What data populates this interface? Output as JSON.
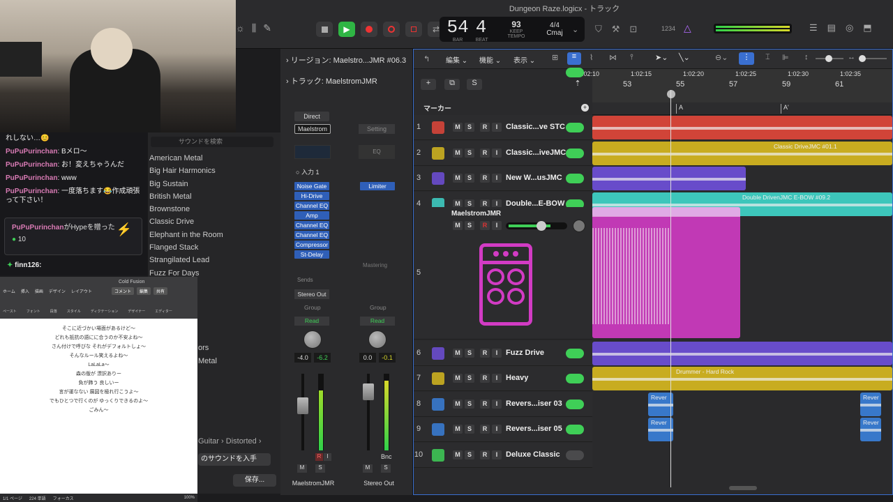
{
  "window_title": "Dungeon Raze.logicx - トラック",
  "lcd": {
    "bar": "54",
    "beat": "4",
    "bar_label": "BAR",
    "beat_label": "BEAT",
    "tempo": "93",
    "keep": "KEEP",
    "tempo_label": "TEMPO",
    "sig": "4/4",
    "key": "Cmaj",
    "count": "1234"
  },
  "chat": {
    "lines": [
      {
        "user": "",
        "text": "れしない…😊"
      },
      {
        "user": "PuPuPurinchan",
        "text": ": Bメロ〜"
      },
      {
        "user": "PuPuPurinchan",
        "text": ": お！変えちゃうんだ"
      },
      {
        "user": "PuPuPurinchan",
        "text": ": www"
      },
      {
        "user": "PuPuPurinchan",
        "text": ": 一度落ちます😂作成頑張って下さい！"
      }
    ],
    "hype_user": "PuPuPurinchan",
    "hype_text": "がHypeを贈った",
    "hype_count": "10",
    "last_user": "finn126:"
  },
  "library": {
    "search_placeholder": "サウンドを検索",
    "items": [
      "American Metal",
      "Big Hair Harmonics",
      "Big Sustain",
      "British Metal",
      "Brownstone",
      "Classic Drive",
      "Elephant in the Room",
      "Flanged Stack",
      "Strangilated Lead",
      "Fuzz For Days"
    ],
    "tail1": "ors",
    "tail2": "Metal",
    "path_guitar": "Guitar",
    "path_distorted": "Distorted",
    "get_more": "のサウンドを入手",
    "save": "保存..."
  },
  "doc": {
    "title": "Cold Fusion",
    "ribbon_tabs": [
      "ホーム",
      "挿入",
      "描画",
      "デザイン",
      "レイアウト"
    ],
    "comment": "コメント",
    "edit": "編集",
    "share": "共有",
    "tools": [
      "ペースト",
      "フォント",
      "段落",
      "スタイル",
      "ディクテーション",
      "デザイナー",
      "エディター"
    ],
    "lines": [
      "そこに近づかい場面があるけど〜",
      "どれも抵抗の語にに合うのか不安よね〜",
      "",
      "さん付けで呼びな それがデフォルトしょ〜",
      "そんなルール笑えるよね〜",
      "",
      "LaLaLa〜",
      "森の版が 漂訳ありー",
      "負が飾う 良しいー",
      "言が運なない 展図を極れ行こうよ〜",
      "でもひとつで行くのが ゆっくりできるのよ〜",
      "ごみん〜"
    ],
    "status_page": "1/1 ページ",
    "status_words": "224 単語",
    "status_focus": "フォーカス",
    "zoom": "100%"
  },
  "inspector": {
    "region_label": "リージョン: Maelstro...JMR #06.3",
    "track_label": "トラック: MaelstromJMR",
    "direct": "Direct",
    "plugin_main": "Maelstrom",
    "setting": "Setting",
    "eq": "EQ",
    "input": "入力 1",
    "inserts": [
      "Noise Gate",
      "Hi-Drive",
      "Channel EQ",
      "Amp",
      "Channel EQ",
      "Channel EQ",
      "Compressor",
      "St-Delay"
    ],
    "limiter": "Limiter",
    "mastering": "Mastering",
    "sends": "Sends",
    "stereo_out": "Stereo Out",
    "group": "Group",
    "read": "Read",
    "ch1": {
      "pan": "-4.0",
      "level": "-6.2",
      "name": "MaelstromJMR",
      "r": "R",
      "i": "I",
      "m": "M",
      "s": "S"
    },
    "ch2": {
      "pan": "0.0",
      "level": "-0.1",
      "name": "Stereo Out",
      "bnc": "Bnc",
      "m": "M",
      "s": "S"
    }
  },
  "tracks_toolbar": {
    "edit": "編集",
    "func": "機能",
    "view": "表示",
    "marker": "マーカー"
  },
  "ruler": {
    "times": [
      "1:02:10",
      "1:02:15",
      "1:02:20",
      "1:02:25",
      "1:02:30",
      "1:02:35"
    ],
    "bars": [
      "53",
      "55",
      "57",
      "59",
      "61"
    ],
    "markers": [
      "A",
      "A'"
    ]
  },
  "tracks": [
    {
      "num": "1",
      "name": "Classic...ve STC",
      "color": "#e0473a",
      "toggle": true
    },
    {
      "num": "2",
      "name": "Classic...iveJMC",
      "color": "#d6b81f",
      "toggle": true
    },
    {
      "num": "3",
      "name": "New W...usJMC",
      "color": "#6e4fd8",
      "toggle": true
    },
    {
      "num": "4",
      "name": "Double...E-BOW",
      "color": "#3fd4c8",
      "toggle": true
    },
    {
      "num": "5",
      "name": "MaelstromJMR",
      "color": "#d23bc4",
      "toggle": true
    },
    {
      "num": "6",
      "name": "Fuzz Drive",
      "color": "#6e4fd8",
      "toggle": true
    },
    {
      "num": "7",
      "name": "Heavy",
      "color": "#d6b81f",
      "toggle": true
    },
    {
      "num": "8",
      "name": "Revers...iser 03",
      "color": "#3a7fd8",
      "toggle": true
    },
    {
      "num": "9",
      "name": "Revers...iser 05",
      "color": "#3a7fd8",
      "toggle": true
    },
    {
      "num": "10",
      "name": "Deluxe Classic",
      "color": "#3fcf57",
      "toggle": false
    }
  ],
  "regions": {
    "r2": "Classic DriveJMC #01.1",
    "r4": "Double DrivenJMC E-BOW #09.2",
    "r7": "Drummer - Hard Rock",
    "rev": "Rever"
  },
  "ms": {
    "m": "M",
    "s": "S",
    "r": "R",
    "i": "I"
  }
}
